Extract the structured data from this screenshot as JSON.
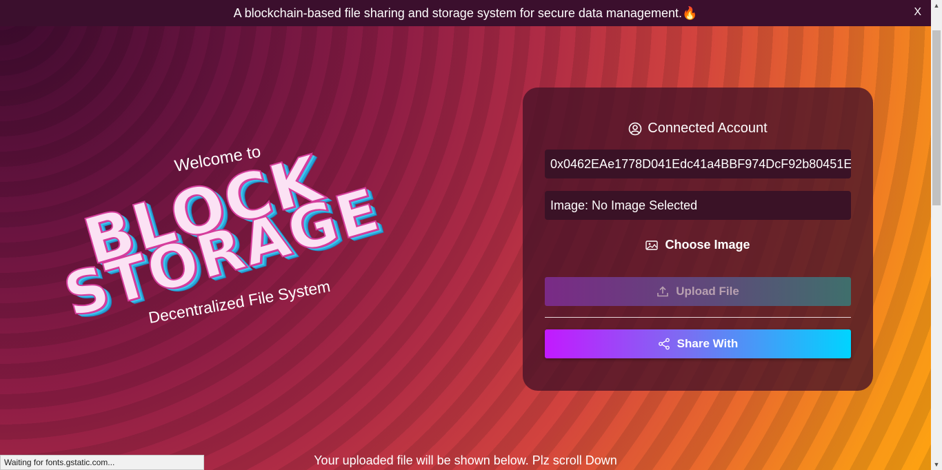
{
  "banner": {
    "text": "A blockchain-based file sharing and storage system for secure data management.🔥",
    "close_label": "X"
  },
  "hero": {
    "welcome": "Welcome to",
    "logo_line1": "BLOCK",
    "logo_line2": "STORAGE",
    "subtitle": "Decentralized File System"
  },
  "card": {
    "account_title": "Connected Account",
    "account_address": "0x0462EAe1778D041Edc41a4BBF974DcF92b80451E",
    "image_status": "Image: No Image Selected",
    "choose_label": "Choose Image",
    "upload_label": "Upload File",
    "share_label": "Share With"
  },
  "footer": {
    "scroll_hint": "Your uploaded file will be shown below. Plz scroll Down"
  },
  "status_bar": {
    "text": "Waiting for fonts.gstatic.com..."
  },
  "icons": {
    "account": "user-circle-icon",
    "choose": "image-icon",
    "upload": "upload-icon",
    "share": "share-icon"
  },
  "colors": {
    "banner_bg": "#3b0f2d",
    "card_bg": "#461228",
    "share_gradient_start": "#c319ff",
    "share_gradient_end": "#00d4ff"
  }
}
